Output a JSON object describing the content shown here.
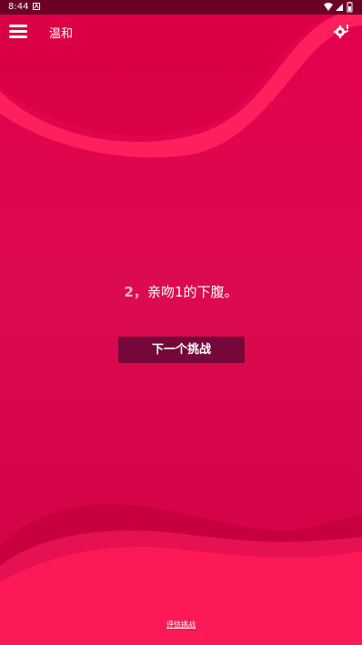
{
  "status_bar": {
    "time": "8:44",
    "notification_icon": "app-notification-icon",
    "icons": [
      "wifi-icon",
      "cell-signal-icon",
      "battery-icon"
    ]
  },
  "app_bar": {
    "menu_icon": "hamburger-menu-icon",
    "title": "温和",
    "settings_icon": "settings-gear-icon"
  },
  "challenge": {
    "number": "2，",
    "text": "亲吻1的下腹。"
  },
  "next_button": {
    "label": "下一个挑战"
  },
  "footer": {
    "link_label": "评估挑战"
  },
  "colors": {
    "background": "#dc0a4e",
    "status_bar": "#6a0025",
    "button": "#76073b",
    "wave_highlight": "#ff1e5a"
  }
}
